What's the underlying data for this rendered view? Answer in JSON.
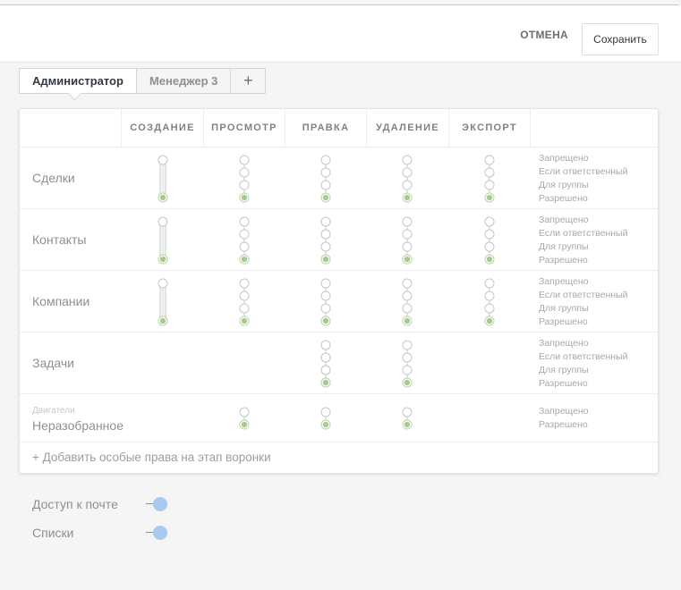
{
  "header": {
    "cancel_label": "ОТМЕНА",
    "save_label": "Сохранить"
  },
  "tabs": [
    {
      "label": "Администратор",
      "active": true
    },
    {
      "label": "Менеджер 3",
      "active": false
    },
    {
      "label": "+",
      "active": false
    }
  ],
  "columns": [
    "СОЗДАНИЕ",
    "ПРОСМОТР",
    "ПРАВКА",
    "УДАЛЕНИЕ",
    "ЭКСПОРТ"
  ],
  "levels_full": [
    "Запрещено",
    "Если ответственный",
    "Для группы",
    "Разрешено"
  ],
  "levels_short": [
    "Запрещено",
    "Разрешено"
  ],
  "rows": [
    {
      "label": "Сделки",
      "sublabel": ""
    },
    {
      "label": "Контакты",
      "sublabel": ""
    },
    {
      "label": "Компании",
      "sublabel": ""
    },
    {
      "label": "Задачи",
      "sublabel": ""
    },
    {
      "label": "Неразобранное",
      "sublabel": "Двигатели"
    }
  ],
  "add_rights_label": "+ Добавить особые права на этап воронки",
  "switches": [
    {
      "label": "Доступ к почте",
      "on": true
    },
    {
      "label": "Списки",
      "on": true
    }
  ],
  "colors": {
    "slider_active": "#b9d3a8",
    "slider_knob": "#a8c98f",
    "toggle_on": "#a9c8f2"
  }
}
